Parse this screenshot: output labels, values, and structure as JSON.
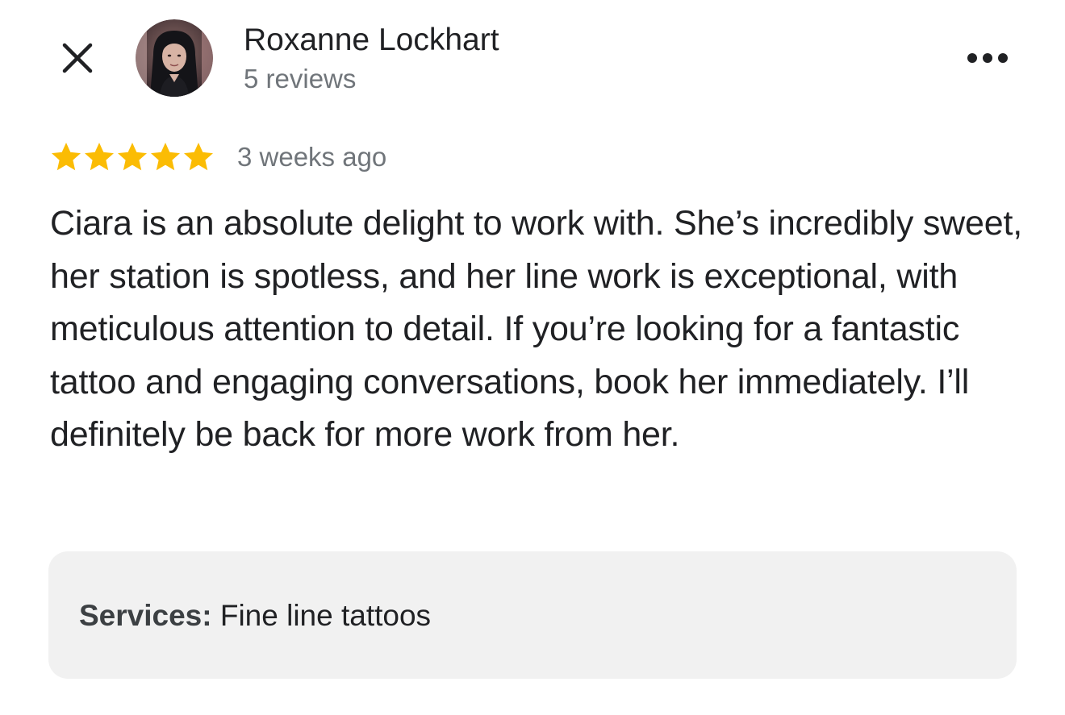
{
  "reviewer": {
    "name": "Roxanne Lockhart",
    "review_count": "5 reviews",
    "avatar_icon": "user-avatar-photo"
  },
  "actions": {
    "close_icon": "close-icon",
    "more_icon": "more-horizontal-icon"
  },
  "review": {
    "rating": 5,
    "rating_max": 5,
    "star_color": "#fbbc04",
    "date": "3 weeks ago",
    "text": "Ciara is an absolute delight to work with. She’s incredibly sweet, her station is spotless, and her line work is exceptional, with meticulous attention to detail. If you’re looking for a fantastic tattoo and engaging conversations, book her immediately. I’ll definitely be back for more work from her."
  },
  "services": {
    "label": "Services:",
    "value": " Fine line tattoos"
  }
}
